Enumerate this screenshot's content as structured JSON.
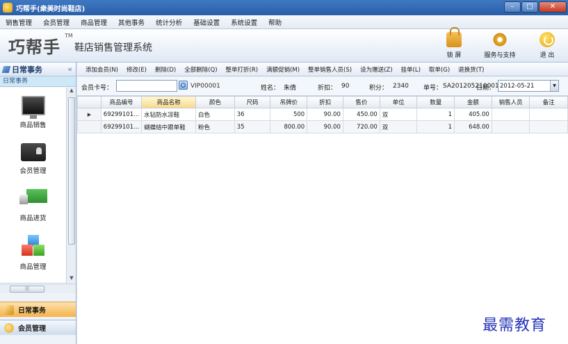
{
  "window": {
    "title": "巧帮手(衆美时尚鞋店)"
  },
  "window_controls": [
    "–",
    "□",
    "✕"
  ],
  "menu": [
    "销售管理",
    "会员管理",
    "商品管理",
    "其他事务",
    "统计分析",
    "基础设置",
    "系统设置",
    "帮助"
  ],
  "header": {
    "logo": "巧帮手",
    "logo_tm": "TM",
    "subtitle": "鞋店销售管理系统",
    "buttons": [
      {
        "label": "锁 屏",
        "icon": "lock-icon"
      },
      {
        "label": "服务与支持",
        "icon": "gear-icon"
      },
      {
        "label": "退 出",
        "icon": "power-icon"
      }
    ]
  },
  "left_panel": {
    "title": "日常事务",
    "collapse": "«",
    "subtitle": "日常事务",
    "items": [
      "商品销售",
      "会员管理",
      "商品进货",
      "商品管理"
    ],
    "hscroll_grip": "|||",
    "bottom_nav": [
      "日常事务",
      "会员管理"
    ]
  },
  "toolbar": [
    "添加会员(N)",
    "修改(E)",
    "删除(D)",
    "全部删除(Q)",
    "整单打折(R)",
    "满额促销(M)",
    "整单销售人员(S)",
    "设为赠送(Z)",
    "挂单(L)",
    "取单(G)",
    "退换货(T)"
  ],
  "info": {
    "card_label": "会员卡号：",
    "card_value": "",
    "vip": "VIP00001",
    "name_label": "姓名：",
    "name_value": "朱倩",
    "discount_label": "折扣：",
    "discount_value": "90",
    "points_label": "积分：",
    "points_value": "2340",
    "order_label": "单号：",
    "order_value": "SA201205210001",
    "date_label": "日期：",
    "date_value": "2012-05-21",
    "date_arrow": "▼"
  },
  "table": {
    "headers": [
      "商品编号",
      "商品名称",
      "颜色",
      "尺码",
      "吊牌价",
      "折扣",
      "售价",
      "单位",
      "数量",
      "金额",
      "销售人员",
      "备注"
    ],
    "current_row_marker": "▶",
    "rows": [
      [
        "69299101...",
        "水钻防水凉鞋",
        "白色",
        "36",
        "500",
        "90.00",
        "450.00",
        "双",
        "1",
        "405.00",
        "",
        ""
      ],
      [
        "69299101...",
        "蝴蝶结中跟单鞋",
        "粉色",
        "35",
        "800.00",
        "90.00",
        "720.00",
        "双",
        "1",
        "648.00",
        "",
        ""
      ]
    ]
  },
  "watermark": "最需教育",
  "colors": {
    "titlebar": "#2a5fa8",
    "active_header": "#f7d98c",
    "left_bottom_active": "#f5b24a"
  }
}
